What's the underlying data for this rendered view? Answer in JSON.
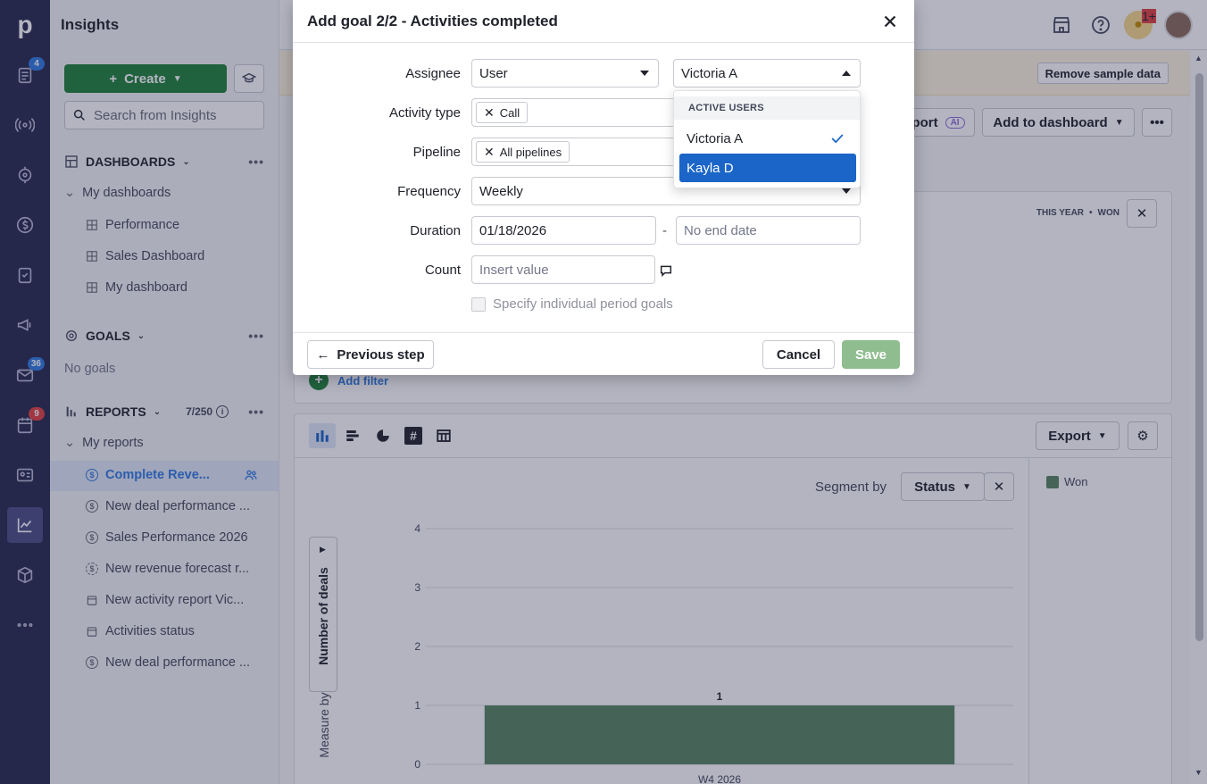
{
  "app": {
    "sidebar_title": "Insights",
    "rail_badges": {
      "activities": "4",
      "mail": "36",
      "calendar": "9",
      "bulb": "1+"
    }
  },
  "sidebar": {
    "create_label": "Create",
    "search_placeholder": "Search from Insights",
    "dashboards": {
      "title": "DASHBOARDS",
      "group": "My dashboards",
      "items": [
        "Performance",
        "Sales Dashboard",
        "My dashboard"
      ]
    },
    "goals": {
      "title": "GOALS",
      "empty": "No goals"
    },
    "reports": {
      "title": "REPORTS",
      "counter": "7/250",
      "group": "My reports",
      "items": [
        {
          "label": "Complete Reve...",
          "icon": "dollar-icon"
        },
        {
          "label": "New deal performance ...",
          "icon": "dollar-icon"
        },
        {
          "label": "Sales Performance 2026",
          "icon": "dollar-icon"
        },
        {
          "label": "New revenue forecast r...",
          "icon": "forecast-icon"
        },
        {
          "label": "New activity report Vic...",
          "icon": "calendar-icon"
        },
        {
          "label": "Activities status",
          "icon": "calendar-icon"
        },
        {
          "label": "New deal performance ...",
          "icon": "dollar-icon"
        }
      ]
    }
  },
  "main": {
    "remove_sample": "Remove sample data",
    "export_report_partial": "port",
    "ai_badge": "AI",
    "add_to_dashboard": "Add to dashboard",
    "card_meta": {
      "period": "THIS YEAR",
      "status": "WON"
    },
    "add_filter": "Add filter",
    "export": "Export",
    "segment_by_label": "Segment by",
    "segment_by_value": "Status",
    "legend_won": "Won",
    "y_axis_label": "Number of deals",
    "measure_by": "Measure by"
  },
  "modal": {
    "title": "Add goal 2/2 - Activities completed",
    "assignee_label": "Assignee",
    "assignee_type": "User",
    "assignee_value": "Victoria A",
    "activity_type_label": "Activity type",
    "activity_type_chip": "Call",
    "pipeline_label": "Pipeline",
    "pipeline_chip": "All pipelines",
    "frequency_label": "Frequency",
    "frequency_value": "Weekly",
    "duration_label": "Duration",
    "duration_start": "01/18/2026",
    "duration_sep": "-",
    "duration_end_placeholder": "No end date",
    "count_label": "Count",
    "count_placeholder": "Insert value",
    "individual_goals": "Specify individual period goals",
    "previous_step": "Previous step",
    "cancel": "Cancel",
    "save": "Save"
  },
  "dropdown": {
    "header": "ACTIVE USERS",
    "options": [
      "Victoria A",
      "Kayla D"
    ],
    "checked": "Victoria A",
    "highlighted": "Kayla D"
  },
  "chart_data": {
    "type": "bar",
    "categories": [
      "W4 2026"
    ],
    "series": [
      {
        "name": "Won",
        "values": [
          1
        ],
        "color": "#57845f"
      }
    ],
    "ylim": [
      0,
      4
    ],
    "yticks": [
      0,
      1,
      2,
      3,
      4
    ],
    "ylabel": "Number of deals",
    "data_labels": [
      "1"
    ]
  }
}
